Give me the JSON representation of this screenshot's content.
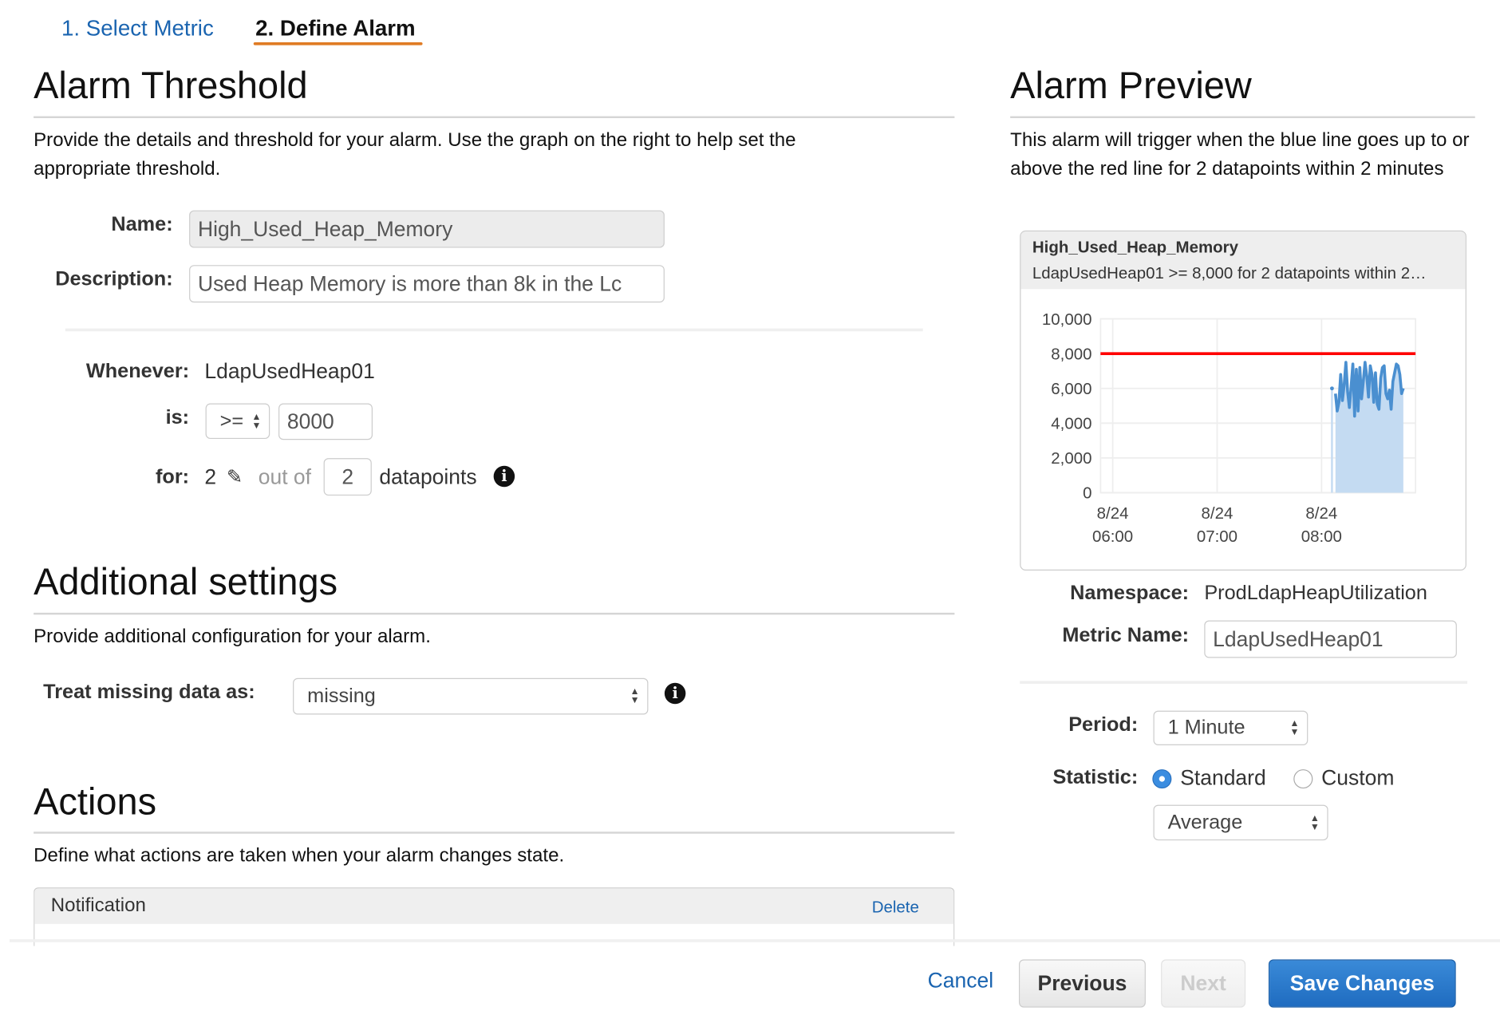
{
  "wizard": {
    "tabs": [
      {
        "label": "1. Select Metric",
        "active": false
      },
      {
        "label": "2. Define Alarm",
        "active": true
      }
    ],
    "accent": "#e07b24",
    "link_color": "#1a64b0"
  },
  "threshold": {
    "title": "Alarm Threshold",
    "description": "Provide the details and threshold for your alarm. Use the graph on the right to help set the appropriate threshold.",
    "name_label": "Name:",
    "name_value": "High_Used_Heap_Memory",
    "description_label": "Description:",
    "description_value": "Used Heap Memory is more than 8k in the Lc",
    "whenever_label": "Whenever:",
    "whenever_value": "LdapUsedHeap01",
    "is_label": "is:",
    "operator": ">=",
    "threshold_value": "8000",
    "for_label": "for:",
    "datapoints_to_alarm": "2",
    "out_of": "out of",
    "evaluation_periods": "2",
    "datapoints": "datapoints",
    "info_icon": "i"
  },
  "additional": {
    "title": "Additional settings",
    "description": "Provide additional configuration for your alarm.",
    "missing_label": "Treat missing data as:",
    "missing_value": "missing"
  },
  "actions": {
    "title": "Actions",
    "description": "Define what actions are taken when your alarm changes state.",
    "notification_label": "Notification",
    "delete_label": "Delete"
  },
  "preview": {
    "title": "Alarm Preview",
    "description": "This alarm will trigger when the blue line goes up to or above the red line for 2 datapoints within 2 minutes",
    "chart_title": "High_Used_Heap_Memory",
    "chart_subtitle": "LdapUsedHeap01 >= 8,000 for 2 datapoints within 2…",
    "namespace_label": "Namespace:",
    "namespace_value": "ProdLdapHeapUtilization",
    "metric_label": "Metric Name:",
    "metric_value": "LdapUsedHeap01",
    "period_label": "Period:",
    "period_value": "1 Minute",
    "statistic_label": "Statistic:",
    "standard_label": "Standard",
    "custom_label": "Custom",
    "selected_statistic": "Standard",
    "statistic_value": "Average"
  },
  "footer": {
    "cancel": "Cancel",
    "previous": "Previous",
    "next": "Next",
    "save": "Save Changes"
  },
  "chart_data": {
    "type": "area",
    "ylim": [
      0,
      10000
    ],
    "yticks": [
      "10,000",
      "8,000",
      "6,000",
      "4,000",
      "2,000",
      "0"
    ],
    "ytick_values": [
      10000,
      8000,
      6000,
      4000,
      2000,
      0
    ],
    "xticks": [
      {
        "date": "8/24",
        "time": "06:00"
      },
      {
        "date": "8/24",
        "time": "07:00"
      },
      {
        "date": "8/24",
        "time": "08:00"
      }
    ],
    "xlim": [
      "05:53",
      "08:54"
    ],
    "grid": true,
    "threshold": {
      "value": 8000,
      "color": "#ff0000"
    },
    "series": {
      "color": "#4a8fd0",
      "fill": "#c4dbf2",
      "isolated_point": {
        "x": "08:06",
        "y": 6000
      },
      "start": "08:08",
      "interval_minutes": 1,
      "values": [
        5700,
        4700,
        5200,
        6800,
        5300,
        6200,
        7500,
        5800,
        4900,
        6100,
        7400,
        4400,
        7100,
        4700,
        7200,
        5400,
        6400,
        7500,
        6700,
        5500,
        7300,
        6800,
        5200,
        6900,
        5100,
        4800,
        6600,
        7200,
        7300,
        5700,
        5400,
        5900,
        4800,
        6400,
        6900,
        7400,
        7300,
        6800,
        5700,
        6000
      ]
    }
  }
}
